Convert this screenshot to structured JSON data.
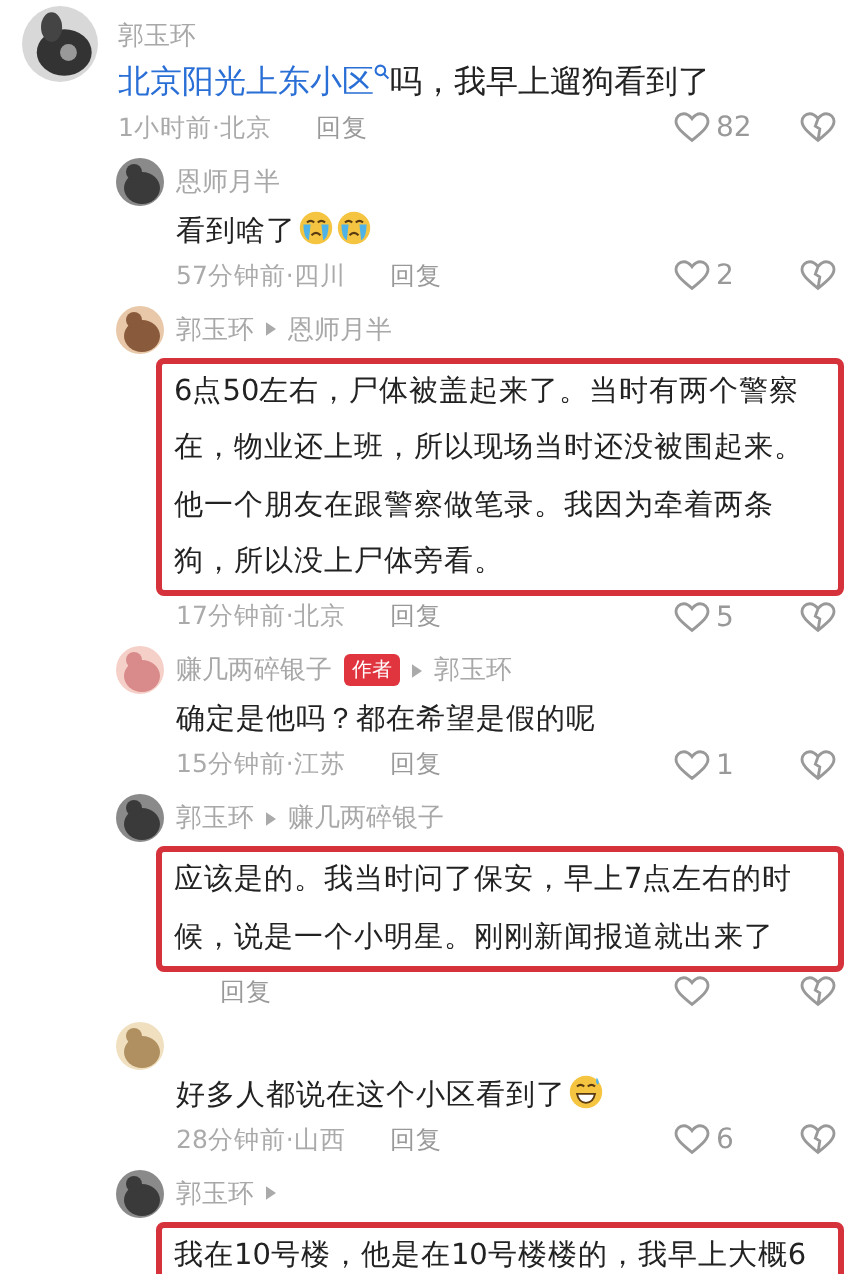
{
  "comments": [
    {
      "author": "郭玉环",
      "link": "北京阳光上东小区",
      "text": "吗，我早上遛狗看到了",
      "time": "1小时前·北京",
      "reply": "回复",
      "likes": "82",
      "replies": [
        {
          "author": "恩师月半",
          "reply_arrow": false,
          "text": "看到啥了",
          "emojis": [
            {
              "kind": "crying"
            },
            {
              "kind": "crying"
            }
          ],
          "highlighted": false,
          "time": "57分钟前·四川",
          "reply": "回复",
          "likes": "2"
        },
        {
          "author": "郭玉环",
          "reply_arrow": true,
          "reply_to": "恩师月半",
          "text": "6点50左右，尸体被盖起来了。当时有两个警察在，物业还上班，所以现场当时还没被围起来。他一个朋友在跟警察做笔录。我因为牵着两条狗，所以没上尸体旁看。",
          "highlighted": true,
          "time": "17分钟前·北京",
          "reply": "回复",
          "likes": "5"
        },
        {
          "author": "赚几两碎银子",
          "badge": "作者",
          "reply_arrow": true,
          "reply_to": "郭玉环",
          "text": "确定是他吗？都在希望是假的呢",
          "highlighted": false,
          "time": "15分钟前·江苏",
          "reply": "回复",
          "likes": "1"
        },
        {
          "author": "郭玉环",
          "reply_arrow": true,
          "reply_to": "赚几两碎银子",
          "text": "应该是的。我当时问了保安，早上7点左右的时候，说是一个小明星。刚刚新闻报道就出来了",
          "highlighted": true,
          "reply": "回复"
        },
        {
          "reply_arrow": false,
          "text": "好多人都说在这个小区看到了",
          "emojis": [
            {
              "kind": "grin-sweat"
            }
          ],
          "highlighted": false,
          "time": "28分钟前·山西",
          "reply": "回复",
          "likes": "6"
        },
        {
          "author": "郭玉环",
          "reply_arrow": true,
          "text": "我在10号楼，他是在10号楼楼的，我早上大概6",
          "highlighted": true
        }
      ]
    }
  ]
}
